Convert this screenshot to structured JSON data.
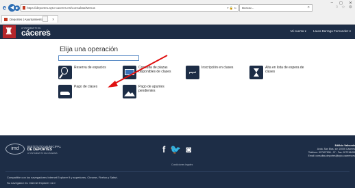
{
  "browser": {
    "url": "https://deportes.ayto-caceres.es/Consultas/Menus",
    "search_text": "Buscar...",
    "tab_title": "Deportes | Ayuntamiento d...",
    "window_controls": [
      "–",
      "◻",
      "✕"
    ]
  },
  "header": {
    "brand_small": "AYUNTAMIENTO DE",
    "brand": "cáceres",
    "menu": [
      "Mi cuenta ▾",
      "Laura Barraga Fernandez ▾"
    ]
  },
  "main": {
    "title": "Elija una operación",
    "operations": [
      {
        "label": "Reserva de espacios",
        "icon": "racket-icon"
      },
      {
        "label": "Consulta de plazas disponibles de clases",
        "icon": "screen-icon"
      },
      {
        "label": "Inscripción en clases",
        "icon": "paper-icon",
        "icon_text": "papel"
      },
      {
        "label": "Alta en lista de espera de clases",
        "icon": "hourglass-icon"
      },
      {
        "label": "Pago de clases",
        "icon": "shoe-icon"
      },
      {
        "label": "Pago de apuntes pendientes",
        "icon": "mountain-icon"
      }
    ]
  },
  "footer": {
    "institute_line1": "INSTITUTO MUNICIPAL",
    "institute_line2": "DE DEPORTES",
    "institute_line3": "AYUNTAMIENTO DE CÁCERES",
    "legal": "Condiciones legales",
    "address_title": "Edificio Valhondo",
    "address_line": "Avda. San Blas, s/n 10005 Cáceres",
    "phone": "Teléfono: 927627508 - 07 - Fax: 927218453",
    "email": "Email: consultas.deportes@ayto-caceres.es",
    "compat_line1": "Compatible con los navegadores Internet Explorer 9 y superiores, Chrome, Firefox y Safari.",
    "compat_line2": "Su navegador es: Internet Explorer 11.0"
  },
  "colors": {
    "header_bg": "#1d2d46",
    "brand_red": "#b5262b",
    "arrow": "#e01010"
  }
}
